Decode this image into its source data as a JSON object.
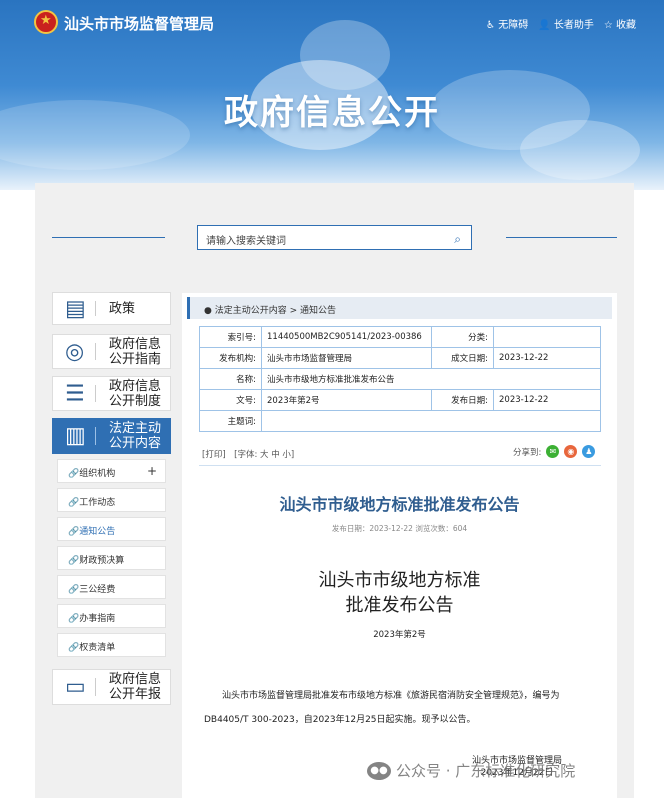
{
  "header": {
    "site_title": "汕头市市场监督管理局",
    "links": [
      "无障碍",
      "长者助手",
      "收藏"
    ],
    "hero": "政府信息公开"
  },
  "search": {
    "placeholder": "请输入搜索关键词"
  },
  "sidebar": {
    "items": [
      {
        "label": "政策",
        "icon": "document-icon"
      },
      {
        "label": "政府信息\n公开指南",
        "icon": "compass-icon"
      },
      {
        "label": "政府信息\n公开制度",
        "icon": "list-icon"
      },
      {
        "label": "法定主动\n公开内容",
        "icon": "file-icon",
        "active": true
      },
      {
        "label": "政府信息\n公开年报",
        "icon": "folder-icon"
      }
    ],
    "subitems": [
      "组织机构",
      "工作动态",
      "通知公告",
      "财政预决算",
      "三公经费",
      "办事指南",
      "权责清单"
    ],
    "expand": "+"
  },
  "breadcrumb": {
    "root": "法定主动公开内容",
    "sep": ">",
    "current": "通知公告"
  },
  "meta": {
    "index_label": "索引号:",
    "index_value": "11440500MB2C905141/2023-00386",
    "category_label": "分类:",
    "category_value": "",
    "issuer_label": "发布机构:",
    "issuer_value": "汕头市市场监督管理局",
    "date_made_label": "成文日期:",
    "date_made_value": "2023-12-22",
    "name_label": "名称:",
    "name_value": "汕头市市级地方标准批准发布公告",
    "docno_label": "文号:",
    "docno_value": "2023年第2号",
    "pub_label": "发布日期:",
    "pub_value": "2023-12-22",
    "subject_label": "主题词:",
    "subject_value": ""
  },
  "tools": {
    "text": "[打印]　[字体: 大  中  小]",
    "share_label": "分享到:"
  },
  "article": {
    "title": "汕头市市级地方标准批准发布公告",
    "info": "发布日期：2023-12-22  浏览次数：604",
    "heading_line1": "汕头市市级地方标准",
    "heading_line2": "批准发布公告",
    "docno": "2023年第2号",
    "body": "汕头市市场监督管理局批准发布市级地方标准《旅游民宿消防安全管理规范》，编号为DB4405/T 300-2023，自2023年12月25日起实施。现予以公告。",
    "sign_org": "汕头市市场监督管理局",
    "sign_date": "2023年12月22日"
  },
  "watermark": {
    "text": "公众号 · 广东标准化研究院"
  }
}
